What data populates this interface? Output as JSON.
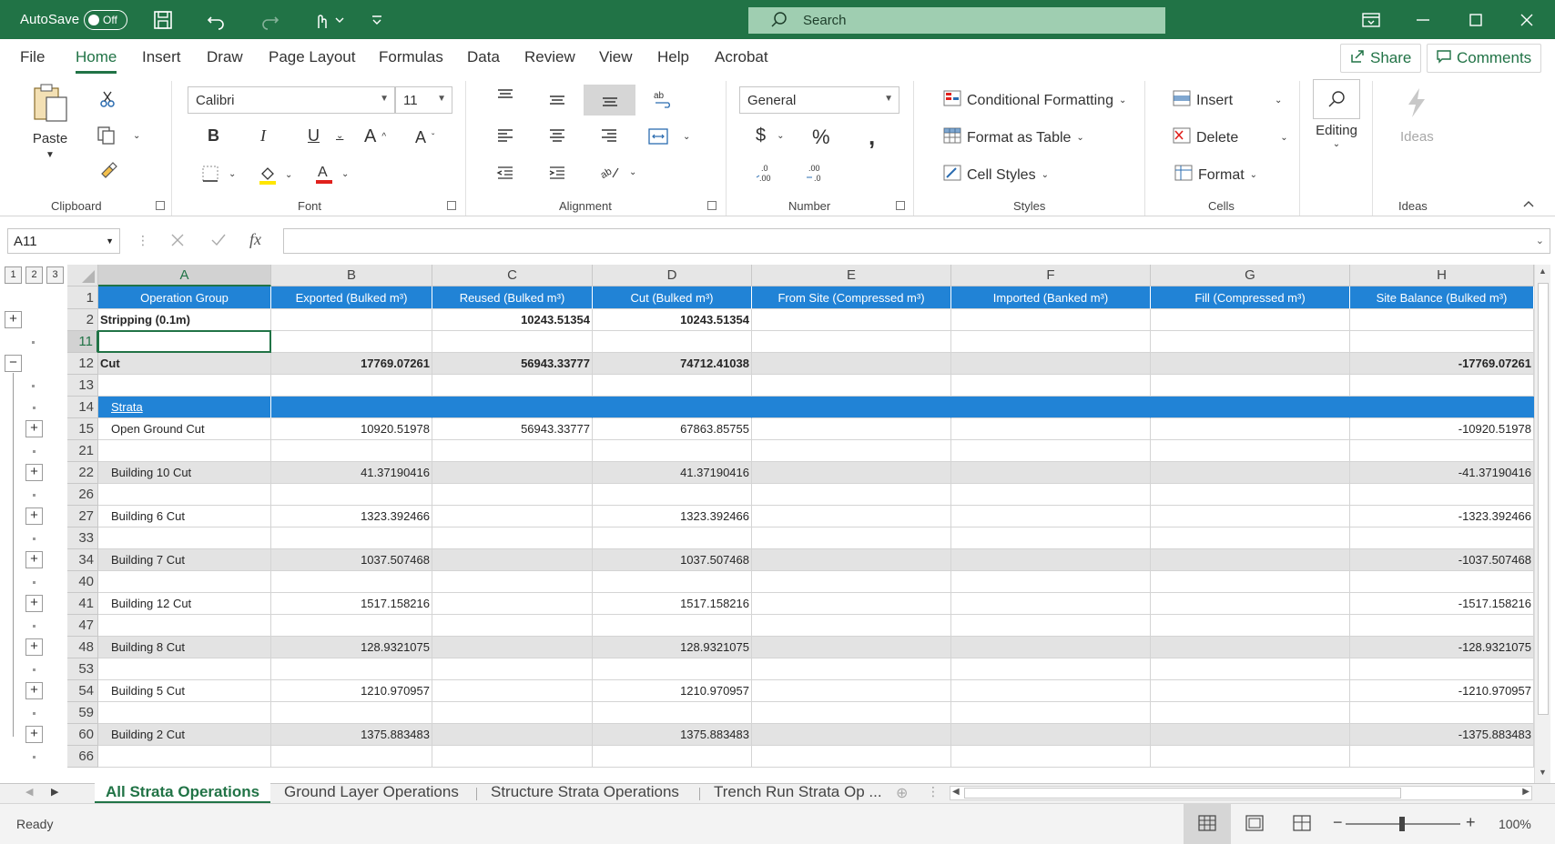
{
  "titlebar": {
    "autosave_label": "AutoSave",
    "autosave_state": "Off",
    "search_placeholder": "Search"
  },
  "ribbon_tabs": [
    "File",
    "Home",
    "Insert",
    "Draw",
    "Page Layout",
    "Formulas",
    "Data",
    "Review",
    "View",
    "Help",
    "Acrobat"
  ],
  "share_label": "Share",
  "comments_label": "Comments",
  "clipboard": {
    "paste_label": "Paste",
    "group_label": "Clipboard"
  },
  "font": {
    "name": "Calibri",
    "size": "11",
    "group_label": "Font"
  },
  "alignment": {
    "group_label": "Alignment"
  },
  "number": {
    "format": "General",
    "group_label": "Number"
  },
  "styles": {
    "conditional_formatting": "Conditional Formatting",
    "format_as_table": "Format as Table",
    "cell_styles": "Cell Styles",
    "group_label": "Styles"
  },
  "cells": {
    "insert": "Insert",
    "delete": "Delete",
    "format": "Format",
    "group_label": "Cells"
  },
  "editing": {
    "label": "Editing"
  },
  "ideas": {
    "label": "Ideas",
    "group_label": "Ideas"
  },
  "formula_bar": {
    "name_box": "A11",
    "formula": ""
  },
  "outline_levels": [
    "1",
    "2",
    "3"
  ],
  "columns": [
    "A",
    "B",
    "C",
    "D",
    "E",
    "F",
    "G",
    "H"
  ],
  "header_row": {
    "row_num": "1",
    "cells": [
      "Operation Group",
      "Exported (Bulked m³)",
      "Reused (Bulked m³)",
      "Cut (Bulked m³)",
      "From Site (Compressed m³)",
      "Imported (Banked m³)",
      "Fill (Compressed m³)",
      "Site Balance (Bulked m³)"
    ]
  },
  "rows": [
    {
      "num": "2",
      "cells": [
        "Stripping (0.1m)",
        "",
        "10243.51354",
        "10243.51354",
        "",
        "",
        "",
        ""
      ]
    },
    {
      "num": "11",
      "cells": [
        "",
        "",
        "",
        "",
        "",
        "",
        "",
        ""
      ]
    },
    {
      "num": "12",
      "cells": [
        "Cut",
        "17769.07261",
        "56943.33777",
        "74712.41038",
        "",
        "",
        "",
        "-17769.07261"
      ]
    },
    {
      "num": "13",
      "cells": [
        "",
        "",
        "",
        "",
        "",
        "",
        "",
        ""
      ]
    },
    {
      "num": "14",
      "cells": [
        "Strata",
        "",
        "",
        "",
        "",
        "",
        "",
        ""
      ]
    },
    {
      "num": "15",
      "cells": [
        "Open Ground Cut",
        "10920.51978",
        "56943.33777",
        "67863.85755",
        "",
        "",
        "",
        "-10920.51978"
      ]
    },
    {
      "num": "21",
      "cells": [
        "",
        "",
        "",
        "",
        "",
        "",
        "",
        ""
      ]
    },
    {
      "num": "22",
      "cells": [
        "Building 10 Cut",
        "41.37190416",
        "",
        "41.37190416",
        "",
        "",
        "",
        "-41.37190416"
      ]
    },
    {
      "num": "26",
      "cells": [
        "",
        "",
        "",
        "",
        "",
        "",
        "",
        ""
      ]
    },
    {
      "num": "27",
      "cells": [
        "Building 6 Cut",
        "1323.392466",
        "",
        "1323.392466",
        "",
        "",
        "",
        "-1323.392466"
      ]
    },
    {
      "num": "33",
      "cells": [
        "",
        "",
        "",
        "",
        "",
        "",
        "",
        ""
      ]
    },
    {
      "num": "34",
      "cells": [
        "Building 7 Cut",
        "1037.507468",
        "",
        "1037.507468",
        "",
        "",
        "",
        "-1037.507468"
      ]
    },
    {
      "num": "40",
      "cells": [
        "",
        "",
        "",
        "",
        "",
        "",
        "",
        ""
      ]
    },
    {
      "num": "41",
      "cells": [
        "Building 12 Cut",
        "1517.158216",
        "",
        "1517.158216",
        "",
        "",
        "",
        "-1517.158216"
      ]
    },
    {
      "num": "47",
      "cells": [
        "",
        "",
        "",
        "",
        "",
        "",
        "",
        ""
      ]
    },
    {
      "num": "48",
      "cells": [
        "Building 8 Cut",
        "128.9321075",
        "",
        "128.9321075",
        "",
        "",
        "",
        "-128.9321075"
      ]
    },
    {
      "num": "53",
      "cells": [
        "",
        "",
        "",
        "",
        "",
        "",
        "",
        ""
      ]
    },
    {
      "num": "54",
      "cells": [
        "Building 5 Cut",
        "1210.970957",
        "",
        "1210.970957",
        "",
        "",
        "",
        "-1210.970957"
      ]
    },
    {
      "num": "59",
      "cells": [
        "",
        "",
        "",
        "",
        "",
        "",
        "",
        ""
      ]
    },
    {
      "num": "60",
      "cells": [
        "Building 2 Cut",
        "1375.883483",
        "",
        "1375.883483",
        "",
        "",
        "",
        "-1375.883483"
      ]
    },
    {
      "num": "66",
      "cells": [
        "",
        "",
        "",
        "",
        "",
        "",
        "",
        ""
      ]
    }
  ],
  "sheet_tabs": [
    "All Strata Operations",
    "Ground Layer Operations",
    "Structure Strata Operations",
    "Trench Run Strata Op ..."
  ],
  "status": {
    "ready": "Ready",
    "zoom": "100%"
  },
  "colors": {
    "accent": "#217346",
    "header_blue": "#2183d6",
    "band_gray": "#e3e3e3"
  }
}
